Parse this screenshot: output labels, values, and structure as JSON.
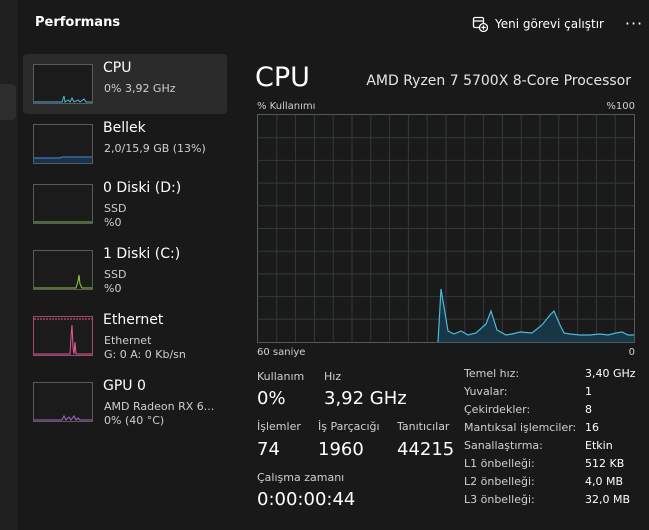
{
  "header": {
    "title": "Performans",
    "new_task_label": "Yeni görevi çalıştır",
    "more_label": "···"
  },
  "sidebar": {
    "items": [
      {
        "name": "CPU",
        "line1": "0% 3,92 GHz",
        "line2": "",
        "active": true,
        "color": "#4fb8d8"
      },
      {
        "name": "Bellek",
        "line1": "2,0/15,9 GB (13%)",
        "line2": "",
        "active": false,
        "color": "#4f8fe0"
      },
      {
        "name": "0 Diski (D:)",
        "line1": "SSD",
        "line2": "%0",
        "active": false,
        "color": "#7fbf3f"
      },
      {
        "name": "1 Diski (C:)",
        "line1": "SSD",
        "line2": "%0",
        "active": false,
        "color": "#8cd13c"
      },
      {
        "name": "Ethernet",
        "line1": "Ethernet",
        "line2": "G: 0 A: 0 Kb/sn",
        "active": false,
        "color": "#e65a9a"
      },
      {
        "name": "GPU 0",
        "line1": "AMD Radeon RX 6...",
        "line2": "0% (40 °C)",
        "active": false,
        "color": "#b05fd0"
      }
    ]
  },
  "main": {
    "title": "CPU",
    "processor": "AMD Ryzen 7 5700X 8-Core Processor",
    "usage_label": "% Kullanımı",
    "max_label": "%100",
    "time_label": "60 saniye",
    "min_label": "0",
    "graph_color": "#4fb8d8",
    "stats": {
      "usage_label": "Kullanım",
      "usage_value": "0%",
      "speed_label": "Hız",
      "speed_value": "3,92 GHz",
      "processes_label": "İşlemler",
      "processes_value": "74",
      "threads_label": "İş Parçacığı",
      "threads_value": "1960",
      "handles_label": "Tanıtıcılar",
      "handles_value": "44215",
      "uptime_label": "Çalışma zamanı",
      "uptime_value": "0:00:00:44"
    },
    "specs": [
      {
        "key": "Temel hız:",
        "value": "3,40 GHz"
      },
      {
        "key": "Yuvalar:",
        "value": "1"
      },
      {
        "key": "Çekirdekler:",
        "value": "8"
      },
      {
        "key": "Mantıksal işlemciler:",
        "value": "16"
      },
      {
        "key": "Sanallaştırma:",
        "value": "Etkin"
      },
      {
        "key": "L1 önbelleği:",
        "value": "512 KB"
      },
      {
        "key": "L2 önbelleği:",
        "value": "4,0 MB"
      },
      {
        "key": "L3 önbelleği:",
        "value": "32,0 MB"
      }
    ]
  }
}
